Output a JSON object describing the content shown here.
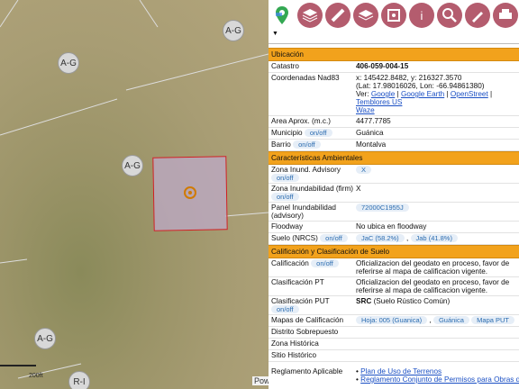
{
  "map": {
    "zone_labels": [
      "A-G",
      "A-G",
      "A-G",
      "A-G",
      "R-I"
    ],
    "scale_label": "200ft",
    "powered": "Pow"
  },
  "toolbar": {
    "icons": [
      "google-maps-icon",
      "layers-icon",
      "layer-switch-icon",
      "stack-icon",
      "gps-icon",
      "info-icon",
      "search-icon",
      "draw-icon",
      "print-icon"
    ]
  },
  "panel": {
    "collapse_glyph": "▼",
    "ubicacion_title": "Ubicación",
    "catastro_label": "Catastro",
    "catastro_value": "406-059-004-15",
    "coords_label": "Coordenadas Nad83",
    "coords_line1": "x: 145422.8482, y: 216327.3570",
    "coords_line2": "(Lat: 17.98016026, Lon: -66.94861380)",
    "ver_label": "Ver:",
    "links": [
      "Google",
      "Google Earth",
      "OpenStreet",
      "Temblores US",
      "Waze"
    ],
    "area_label": "Area Aprox. (m.c.)",
    "area_value": "4477.7785",
    "municipio_label": "Municipio",
    "municipio_value": "Guánica",
    "barrio_label": "Barrio",
    "barrio_value": "Montalva",
    "onoff": "on/off",
    "amb_title": "Características Ambientales",
    "zona_inund_adv_label": "Zona Inund. Advisory",
    "zona_inund_adv_value": "X",
    "zona_inund_firm_label": "Zona Inundabilidad (firm)",
    "zona_inund_firm_value": "X",
    "panel_inund_label": "Panel Inundabilidad (advisory)",
    "panel_inund_value": "72000C1955J",
    "floodway_label": "Floodway",
    "floodway_value": "No ubica en floodway",
    "suelo_label": "Suelo (NRCS)",
    "suelo_values": [
      "JaC (58.2%)",
      "Jab (41.8%)"
    ],
    "calif_title": "Calificación y Clasificación de Suelo",
    "calificacion_label": "Calificación",
    "calificacion_value": "Oficializacion del geodato en proceso, favor de referirse al mapa de calificacion vigente.",
    "clasif_pt_label": "Clasificación PT",
    "clasif_pt_value": "Oficializacion del geodato en proceso, favor de referirse al mapa de calificacion vigente.",
    "clasif_put_label": "Clasificación PUT",
    "clasif_put_code": "SRC",
    "clasif_put_desc": "(Suelo Rústico Común)",
    "mapas_label": "Mapas de Calificación",
    "mapas_values": [
      "Hoja: 005 (Guanica)",
      "Guánica",
      "Mapa PUT"
    ],
    "distrito_label": "Distrito Sobrepuesto",
    "zona_hist_label": "Zona Histórica",
    "sitio_hist_label": "Sitio Histórico",
    "reglamento_label": "Reglamento Aplicable",
    "reglamento_links": [
      "Plan de Uso de Terrenos",
      "Reglamento Conjunto de Permisos para Obras de Construcción"
    ]
  }
}
